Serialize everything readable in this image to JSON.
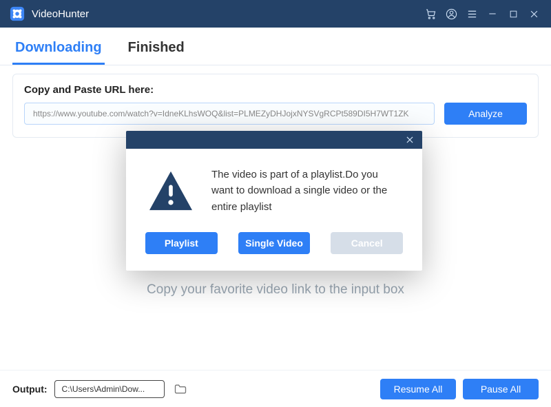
{
  "app": {
    "title": "VideoHunter"
  },
  "tabs": {
    "downloading": "Downloading",
    "finished": "Finished",
    "active": "downloading"
  },
  "url_panel": {
    "label": "Copy and Paste URL here:",
    "value": "https://www.youtube.com/watch?v=IdneKLhsWOQ&list=PLMEZyDHJojxNYSVgRCPt589DI5H7WT1ZK",
    "analyze": "Analyze"
  },
  "empty_hint": "Copy your favorite video link to the input box",
  "footer": {
    "output_label": "Output:",
    "output_path": "C:\\Users\\Admin\\Dow...",
    "resume_all": "Resume All",
    "pause_all": "Pause All"
  },
  "modal": {
    "message": "The video is part of a playlist.Do you want to download a single video or the entire playlist",
    "playlist": "Playlist",
    "single": "Single Video",
    "cancel": "Cancel"
  }
}
